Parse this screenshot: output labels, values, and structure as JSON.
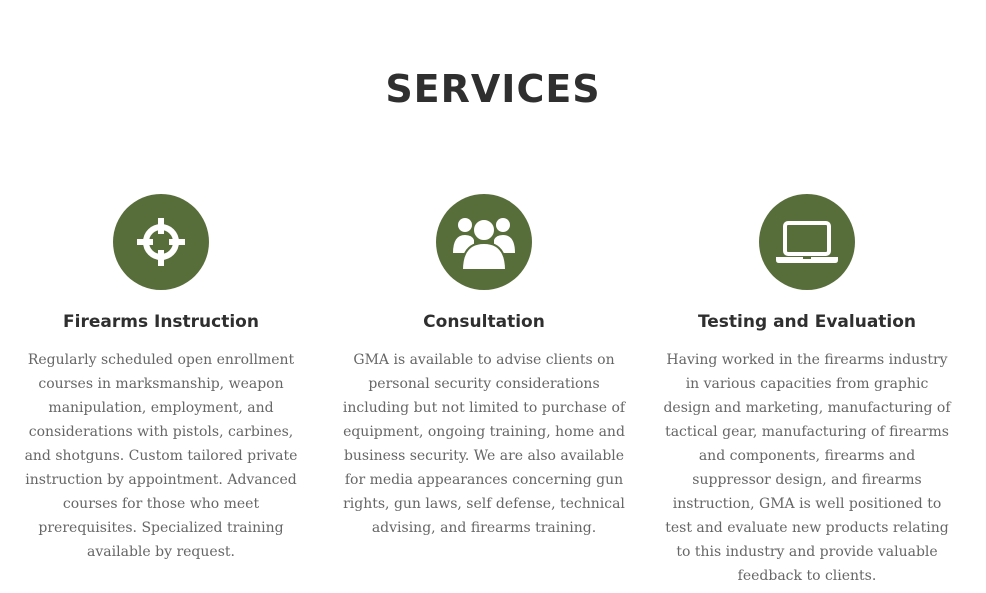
{
  "page": {
    "title": "SERVICES"
  },
  "colors": {
    "accent": "#586e3a",
    "heading": "#2f2f2f",
    "body_text": "#666666"
  },
  "services": [
    {
      "icon": "crosshair-icon",
      "title": "Firearms Instruction",
      "description": "Regularly scheduled open enrollment courses in marksmanship, weapon manipulation, employment, and considerations with pistols, carbines, and shotguns. Custom tailored private instruction by appointment. Advanced courses for those who meet prerequisites. Specialized training available by request."
    },
    {
      "icon": "users-icon",
      "title": "Consultation",
      "description": "GMA is available to advise clients on personal security considerations including but not limited to purchase of equipment, ongoing training, home and business security. We are also available for media appearances concerning gun rights, gun laws, self defense, technical advising, and firearms training."
    },
    {
      "icon": "laptop-icon",
      "title": "Testing and Evaluation",
      "description": "Having worked in the firearms industry in various capacities from graphic design and marketing, manufacturing of tactical gear, manufacturing of firearms and components, firearms and suppressor design, and firearms instruction, GMA is well positioned to test and evaluate new products relating to this industry and provide valuable feedback to clients."
    }
  ]
}
